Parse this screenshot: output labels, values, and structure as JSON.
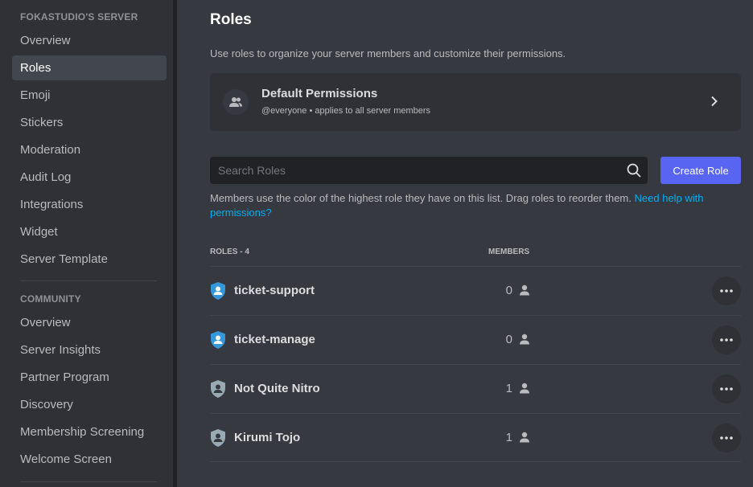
{
  "sidebar": {
    "server_header": "FOKASTUDIO'S SERVER",
    "items": [
      {
        "label": "Overview",
        "active": false
      },
      {
        "label": "Roles",
        "active": true
      },
      {
        "label": "Emoji",
        "active": false
      },
      {
        "label": "Stickers",
        "active": false
      },
      {
        "label": "Moderation",
        "active": false
      },
      {
        "label": "Audit Log",
        "active": false
      },
      {
        "label": "Integrations",
        "active": false
      },
      {
        "label": "Widget",
        "active": false
      },
      {
        "label": "Server Template",
        "active": false
      }
    ],
    "community_header": "COMMUNITY",
    "community_items": [
      {
        "label": "Overview"
      },
      {
        "label": "Server Insights"
      },
      {
        "label": "Partner Program"
      },
      {
        "label": "Discovery"
      },
      {
        "label": "Membership Screening"
      },
      {
        "label": "Welcome Screen"
      }
    ]
  },
  "main": {
    "title": "Roles",
    "description": "Use roles to organize your server members and customize their permissions.",
    "default_permissions": {
      "title": "Default Permissions",
      "subtitle": "@everyone • applies to all server members",
      "icon": "members-icon"
    },
    "search": {
      "placeholder": "Search Roles",
      "value": ""
    },
    "create_button": "Create Role",
    "help_text": "Members use the color of the highest role they have on this list. Drag roles to reorder them.",
    "help_link": "Need help with permissions?",
    "columns": {
      "roles": "ROLES - 4",
      "members": "MEMBERS"
    },
    "roles": [
      {
        "name": "ticket-support",
        "members": "0",
        "color": "#3498db"
      },
      {
        "name": "ticket-manage",
        "members": "0",
        "color": "#3498db"
      },
      {
        "name": "Not Quite Nitro",
        "members": "1",
        "color": "#99aab5"
      },
      {
        "name": "Kirumi Tojo",
        "members": "1",
        "color": "#99aab5"
      }
    ]
  },
  "colors": {
    "accent": "#5865f2",
    "link": "#00aff4",
    "background": "#36393f",
    "sidebar": "#2f3136"
  }
}
